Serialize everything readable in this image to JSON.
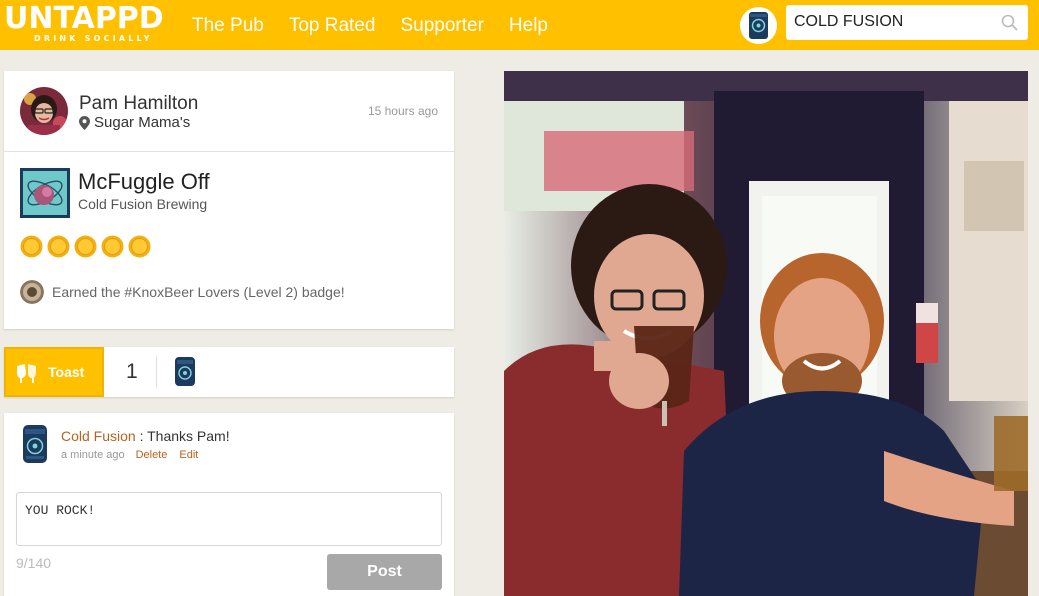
{
  "header": {
    "logo_main": "UNTAPPD",
    "logo_sub": "DRINK SOCIALLY",
    "nav": [
      {
        "label": "The Pub"
      },
      {
        "label": "Top Rated"
      },
      {
        "label": "Supporter"
      },
      {
        "label": "Help"
      }
    ],
    "search": {
      "value": "COLD FUSION",
      "icon": "search-icon"
    },
    "user_avatar_icon": "cold-fusion-avatar"
  },
  "checkin": {
    "user_name": "Pam Hamilton",
    "venue": "Sugar Mama's",
    "time": "15 hours ago",
    "beer_name": "McFuggle Off",
    "brewery": "Cold Fusion Brewing",
    "rating": 5,
    "rating_max": 5,
    "badge_text": "Earned the #KnoxBeer Lovers (Level 2) badge!"
  },
  "toast": {
    "label": "Toast",
    "count": "1"
  },
  "comment": {
    "author": "Cold Fusion",
    "separator": " : ",
    "text": "Thanks Pam!",
    "time": "a minute ago",
    "delete_label": "Delete",
    "edit_label": "Edit"
  },
  "reply": {
    "value": "YOU ROCK!",
    "char_count": "9/140",
    "post_label": "Post"
  },
  "colors": {
    "brand": "#ffc000",
    "link": "#b5651d",
    "disabled": "#a8a8a8"
  }
}
